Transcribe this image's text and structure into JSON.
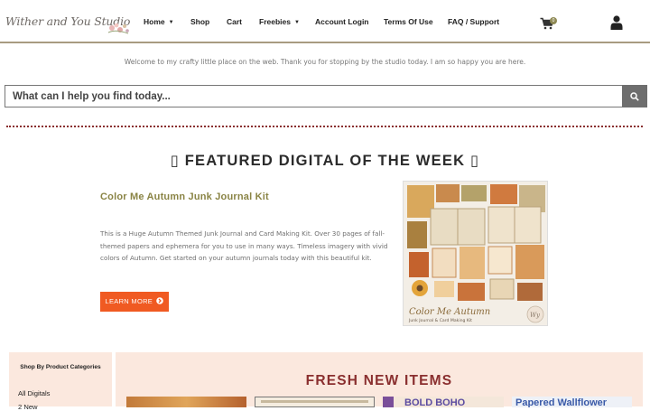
{
  "header": {
    "logo_text": "Wither and You Studio",
    "nav": [
      {
        "label": "Home",
        "has_dropdown": true
      },
      {
        "label": "Shop",
        "has_dropdown": false
      },
      {
        "label": "Cart",
        "has_dropdown": false
      },
      {
        "label": "Freebies",
        "has_dropdown": true
      },
      {
        "label": "Account Login",
        "has_dropdown": false
      },
      {
        "label": "Terms Of Use",
        "has_dropdown": false
      },
      {
        "label": "FAQ / Support",
        "has_dropdown": false
      }
    ],
    "cart_count": "0",
    "icons": {
      "cart": "cart-icon",
      "user": "user-icon",
      "dropdown": "chevron-down-icon"
    }
  },
  "welcome_text": "Welcome to my crafty little place on the web. Thank you for stopping by the studio today. I am so happy you are here.",
  "search": {
    "placeholder": "What can I help you find today...",
    "value": "",
    "icon": "search-icon"
  },
  "featured": {
    "heading": "FEATURED DIGITAL OF THE WEEK",
    "heading_glyph": "▯",
    "product_title": "Color Me Autumn Junk Journal Kit",
    "description": "This is a Huge Autumn Themed Junk Journal and Card Making Kit. Over 30 pages of fall-themed papers and ephemera for you to use in many ways. Timeless imagery with vivid colors of Autumn. Get started on your autumn journals today with this beautiful kit.",
    "button_label": "LEARN MORE",
    "button_icon": "chevron-right-circle-icon",
    "image_caption_title": "Color Me Autumn",
    "image_caption_sub": "Junk Journal & Card Making Kit",
    "image_signature": "Wy"
  },
  "sidebar": {
    "title": "Shop By Product Categories",
    "items": [
      "All Digitals",
      "2 New"
    ]
  },
  "fresh": {
    "heading": "FRESH NEW ITEMS",
    "thumbs": [
      {
        "text": ""
      },
      {
        "text": ""
      },
      {
        "text": "BOLD BOHO"
      },
      {
        "text": "Papered Wallflower"
      }
    ]
  },
  "colors": {
    "accent_olive": "#8a8445",
    "button_orange": "#f05a22",
    "fresh_red": "#8a2f2f",
    "panel_peach": "#fbe8de"
  }
}
